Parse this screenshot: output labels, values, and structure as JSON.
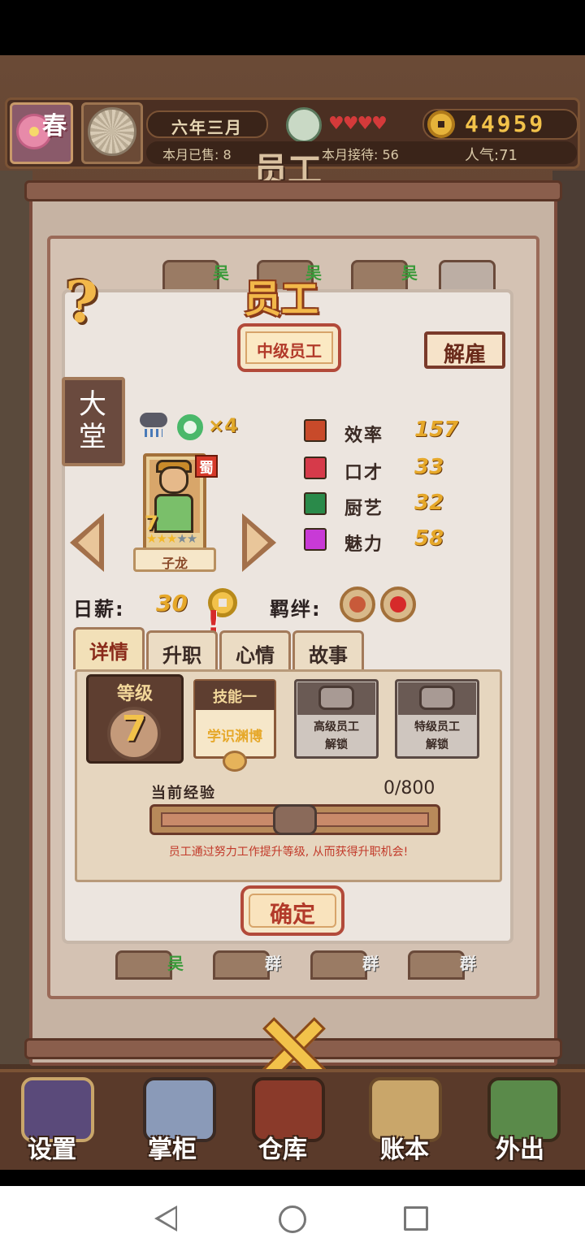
{
  "hud": {
    "season": "春",
    "date": "六年三月",
    "hearts": "♥♥♥♥",
    "coins": "44959",
    "sold_month": "本月已售: 8",
    "received_month": "本月接待: 56",
    "popularity": "人气:71",
    "overlay_title": "员工"
  },
  "dialog": {
    "title": "员工",
    "help": "?",
    "rank": "中级员工",
    "fire_button": "解雇",
    "department": "大堂",
    "jade_count": "×4",
    "employee": {
      "name": "子龙",
      "faction": "蜀",
      "level_badge": "7",
      "stars_filled": "★★★",
      "stars_empty": "★★"
    },
    "attributes": [
      {
        "label": "效率",
        "value": "157",
        "icon_color": "#c84a2a"
      },
      {
        "label": "口才",
        "value": "33",
        "icon_color": "#d63a4a"
      },
      {
        "label": "厨艺",
        "value": "32",
        "icon_color": "#2a8a4a"
      },
      {
        "label": "魅力",
        "value": "58",
        "icon_color": "#c83ad6"
      }
    ],
    "salary_label": "日薪:",
    "salary_value": "30",
    "bond_label": "羁绊:",
    "tabs": [
      "详情",
      "升职",
      "心情",
      "故事"
    ],
    "level_title": "等级",
    "level_value": "7",
    "skill": {
      "title": "技能一",
      "name": "学识渊博"
    },
    "locked_slots": [
      {
        "line1": "高级员工",
        "line2": "解锁"
      },
      {
        "line1": "特级员工",
        "line2": "解锁"
      }
    ],
    "exp_label": "当前经验",
    "exp_value": "0/800",
    "exp_progress": 0,
    "hint": "员工通过努力工作提升等级, 从而获得升职机会!",
    "confirm": "确定"
  },
  "background_tags": [
    "吴",
    "吴",
    "吴",
    "吴",
    "群",
    "群",
    "群"
  ],
  "bottom_nav": [
    {
      "label": "设置",
      "icon": "yin-yang-icon",
      "color": "#5a4a7a"
    },
    {
      "label": "掌柜",
      "icon": "shopkeeper-icon",
      "color": "#8a9ab8"
    },
    {
      "label": "仓库",
      "icon": "chest-icon",
      "color": "#8a3a2a"
    },
    {
      "label": "账本",
      "icon": "scrolls-icon",
      "color": "#c9a66a"
    },
    {
      "label": "外出",
      "icon": "bundle-icon",
      "color": "#5a8a4a"
    }
  ]
}
